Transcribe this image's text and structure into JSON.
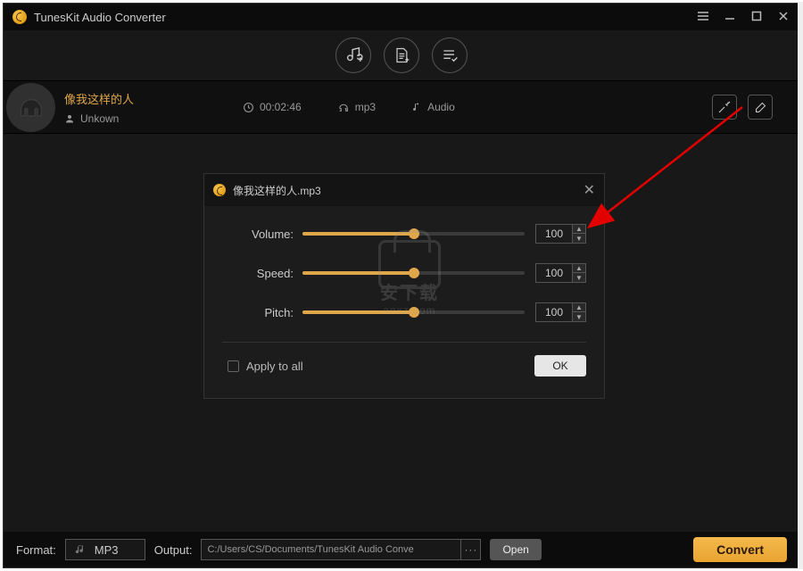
{
  "app": {
    "title": "TunesKit Audio Converter"
  },
  "track": {
    "title": "像我这样的人",
    "artist": "Unkown",
    "duration": "00:02:46",
    "format": "mp3",
    "type": "Audio"
  },
  "panel": {
    "file": "像我这样的人.mp3",
    "sliders": {
      "volume": {
        "label": "Volume:",
        "value": "100",
        "percent": 50
      },
      "speed": {
        "label": "Speed:",
        "value": "100",
        "percent": 50
      },
      "pitch": {
        "label": "Pitch:",
        "value": "100",
        "percent": 50
      }
    },
    "apply_all": "Apply to all",
    "ok": "OK"
  },
  "bottom": {
    "format_label": "Format:",
    "format_value": "MP3",
    "output_label": "Output:",
    "output_path": "C:/Users/CS/Documents/TunesKit Audio Conve",
    "open": "Open",
    "convert": "Convert"
  },
  "watermark": {
    "text": "安下载",
    "url": "anxz.com"
  }
}
